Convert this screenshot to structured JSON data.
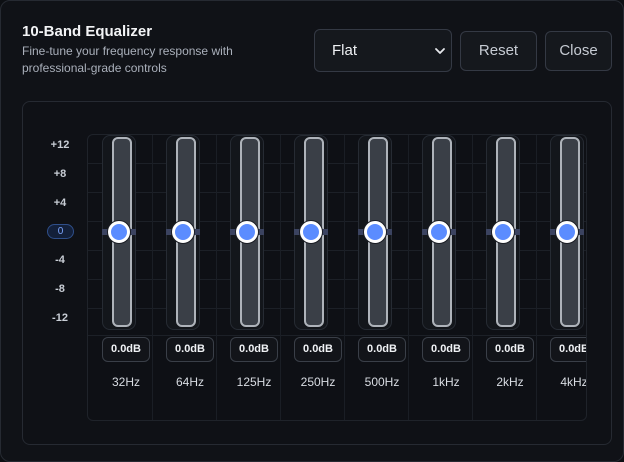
{
  "header": {
    "title": "10-Band Equalizer",
    "subtitle": "Fine-tune your frequency response with professional-grade controls"
  },
  "controls": {
    "preset_selected": "Flat",
    "reset_label": "Reset",
    "close_label": "Close"
  },
  "scale": [
    "+12",
    "+8",
    "+4",
    "0",
    "-4",
    "-8",
    "-12"
  ],
  "bands": [
    {
      "freq": "32Hz",
      "gain": "0.0dB",
      "value": 0
    },
    {
      "freq": "64Hz",
      "gain": "0.0dB",
      "value": 0
    },
    {
      "freq": "125Hz",
      "gain": "0.0dB",
      "value": 0
    },
    {
      "freq": "250Hz",
      "gain": "0.0dB",
      "value": 0
    },
    {
      "freq": "500Hz",
      "gain": "0.0dB",
      "value": 0
    },
    {
      "freq": "1kHz",
      "gain": "0.0dB",
      "value": 0
    },
    {
      "freq": "2kHz",
      "gain": "0.0dB",
      "value": 0
    },
    {
      "freq": "4kHz",
      "gain": "0.0dB",
      "value": 0
    }
  ],
  "colors": {
    "accent": "#5b8cff",
    "background": "#101217"
  },
  "icons": {
    "preset_dropdown": "chevron-down-icon"
  }
}
